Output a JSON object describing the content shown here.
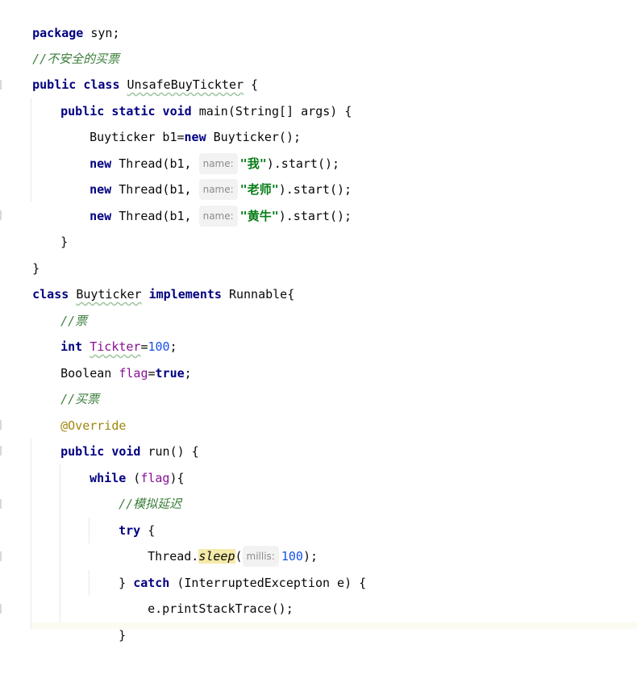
{
  "lines": [
    {
      "id": "l1",
      "t1": "package",
      "t2": " syn;"
    },
    {
      "id": "l2",
      "comment": "//不安全的买票"
    },
    {
      "id": "l3",
      "t1": "public class",
      "t2": " ",
      "cls": "UnsafeBuyTickter",
      "t3": " {"
    },
    {
      "id": "l4",
      "t1": "public static void",
      "t2": " main(String[] args) {"
    },
    {
      "id": "l5",
      "t1": "Buyticker b1=",
      "t2": "new",
      "t3": " Buyticker();"
    },
    {
      "id": "l6",
      "t1": "new",
      "t2": " Thread(b1, ",
      "hint": "name:",
      "str": "\"我\"",
      "t3": ").start();"
    },
    {
      "id": "l7",
      "t1": "new",
      "t2": " Thread(b1, ",
      "hint": "name:",
      "str": "\"老师\"",
      "t3": ").start();"
    },
    {
      "id": "l8",
      "t1": "new",
      "t2": " Thread(b1, ",
      "hint": "name:",
      "str": "\"黄牛\"",
      "t3": ").start();"
    },
    {
      "id": "l9",
      "t1": "}"
    },
    {
      "id": "l10",
      "t1": "}"
    },
    {
      "id": "l11",
      "t1": "class",
      "cls": "Buyticker",
      "t2": "implements",
      "t3": " Runnable{"
    },
    {
      "id": "l12",
      "comment": "//票"
    },
    {
      "id": "l13",
      "t1": "int",
      "fld": "Tickter",
      "t2": "=",
      "num": "100",
      "t3": ";"
    },
    {
      "id": "l14",
      "t1": "Boolean ",
      "fld": "flag",
      "t2": "=",
      "kw2": "true",
      "t3": ";"
    },
    {
      "id": "l15",
      "comment": "//买票"
    },
    {
      "id": "l16",
      "ann": "@Override"
    },
    {
      "id": "l17",
      "t1": "public void",
      "t2": " run() {"
    },
    {
      "id": "l18",
      "t1": "while",
      "t2": " (",
      "fld": "flag",
      "t3": "){"
    },
    {
      "id": "l19",
      "comment": "//模拟延迟"
    },
    {
      "id": "l20",
      "t1": "try",
      "t2": " {"
    },
    {
      "id": "l21",
      "t1": "Thread.",
      "fn": "sleep",
      "t2": "(",
      "hint": "millis:",
      "num": "100",
      "t3": ");"
    },
    {
      "id": "l22",
      "t1": "} ",
      "kw": "catch",
      "t2": " (InterruptedException e) {"
    },
    {
      "id": "l23",
      "t1": "e.printStackTrace();"
    },
    {
      "id": "l24",
      "t1": "}"
    }
  ]
}
